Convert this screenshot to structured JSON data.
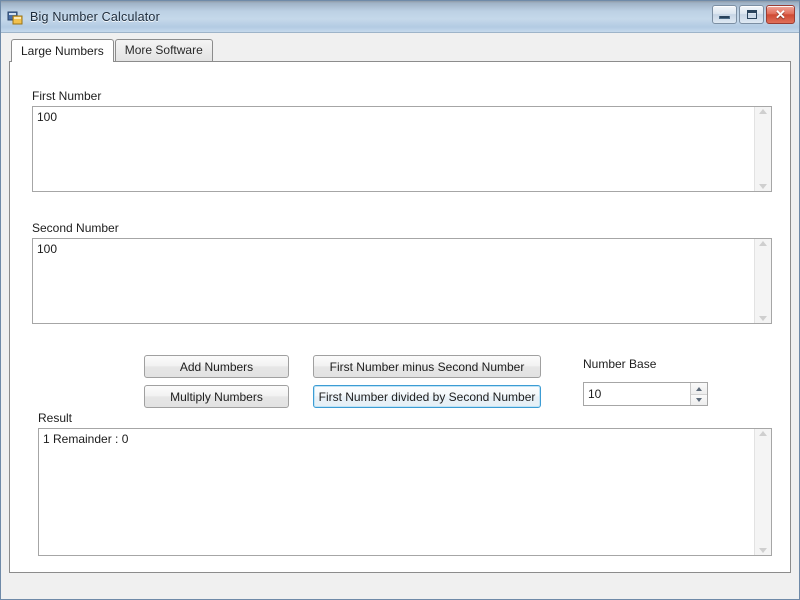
{
  "window": {
    "title": "Big Number Calculator",
    "icon": "app-icon",
    "controls": {
      "minimize": "minimize-icon",
      "maximize": "maximize-icon",
      "close": "close-icon",
      "close_glyph": "✕"
    }
  },
  "tabs": [
    {
      "label": "Large Numbers",
      "active": true
    },
    {
      "label": "More Software",
      "active": false
    }
  ],
  "form": {
    "first_number": {
      "label": "First Number",
      "value": "100",
      "placeholder": ""
    },
    "second_number": {
      "label": "Second Number",
      "value": "100",
      "placeholder": ""
    },
    "result": {
      "label": "Result",
      "value": "1 Remainder : 0",
      "placeholder": ""
    },
    "number_base": {
      "label": "Number Base",
      "value": "10",
      "placeholder": ""
    }
  },
  "buttons": {
    "add": "Add Numbers",
    "multiply": "Multiply Numbers",
    "subtract": "First Number minus Second Number",
    "divide": "First Number divided by Second Number",
    "focused": "divide"
  },
  "colors": {
    "titlebar_top": "#8d9aa8",
    "titlebar_mid": "#c5d8ea",
    "close_button": "#cf4a34",
    "focus_border": "#3c9cd4",
    "panel_background": "#ffffff",
    "client_background": "#f0f0f0",
    "text": "#1d1d1d"
  }
}
